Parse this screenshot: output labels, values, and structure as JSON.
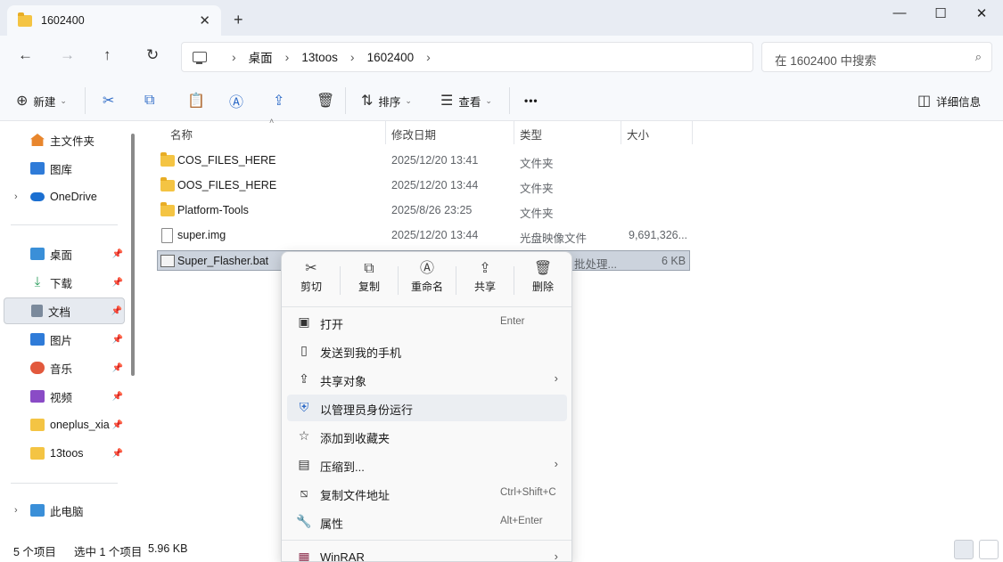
{
  "tab": {
    "title": "1602400",
    "close": "✕",
    "new": "+"
  },
  "window": {
    "minimize": "—",
    "maximize": "☐",
    "close": "✕"
  },
  "nav": {
    "back": "←",
    "forward": "→",
    "up": "↑",
    "refresh": "↻"
  },
  "breadcrumb": [
    "桌面",
    "13toos",
    "1602400"
  ],
  "search": {
    "placeholder": "在 1602400 中搜索"
  },
  "toolbar": {
    "new": "新建",
    "sort": "排序",
    "view": "查看",
    "more": "•••",
    "details": "详细信息"
  },
  "sidebar": {
    "home": "主文件夹",
    "gallery": "图库",
    "onedrive": "OneDrive",
    "pinned": [
      "桌面",
      "下载",
      "文档",
      "图片",
      "音乐",
      "视频",
      "oneplus_xia",
      "13toos"
    ],
    "thispc": "此电脑"
  },
  "columns": {
    "name": "名称",
    "date": "修改日期",
    "type": "类型",
    "size": "大小"
  },
  "files": [
    {
      "name": "COS_FILES_HERE",
      "date": "2025/12/20 13:41",
      "type": "文件夹",
      "size": ""
    },
    {
      "name": "OOS_FILES_HERE",
      "date": "2025/12/20 13:44",
      "type": "文件夹",
      "size": ""
    },
    {
      "name": "Platform-Tools",
      "date": "2025/8/26 23:25",
      "type": "文件夹",
      "size": ""
    },
    {
      "name": "super.img",
      "date": "2025/12/20 13:44",
      "type": "光盘映像文件",
      "size": "9,691,326..."
    },
    {
      "name": "Super_Flasher.bat",
      "date": "",
      "type": "批处理...",
      "size": "6 KB"
    }
  ],
  "status": {
    "count": "5 个项目",
    "selected": "选中 1 个项目",
    "size": "5.96 KB"
  },
  "context_menu": {
    "quick": [
      "剪切",
      "复制",
      "重命名",
      "共享",
      "删除"
    ],
    "items": [
      {
        "label": "打开",
        "accel": "Enter"
      },
      {
        "label": "发送到我的手机",
        "accel": ""
      },
      {
        "label": "共享对象",
        "accel": ""
      },
      {
        "label": "以管理员身份运行",
        "accel": ""
      },
      {
        "label": "添加到收藏夹",
        "accel": ""
      },
      {
        "label": "压缩到...",
        "accel": ""
      },
      {
        "label": "复制文件地址",
        "accel": "Ctrl+Shift+C"
      },
      {
        "label": "属性",
        "accel": "Alt+Enter"
      },
      {
        "label": "WinRAR",
        "accel": ""
      }
    ]
  },
  "colors": {
    "folder": "#f4c443",
    "accent": "#2e6bc7",
    "selection": "#ccd3dd"
  }
}
